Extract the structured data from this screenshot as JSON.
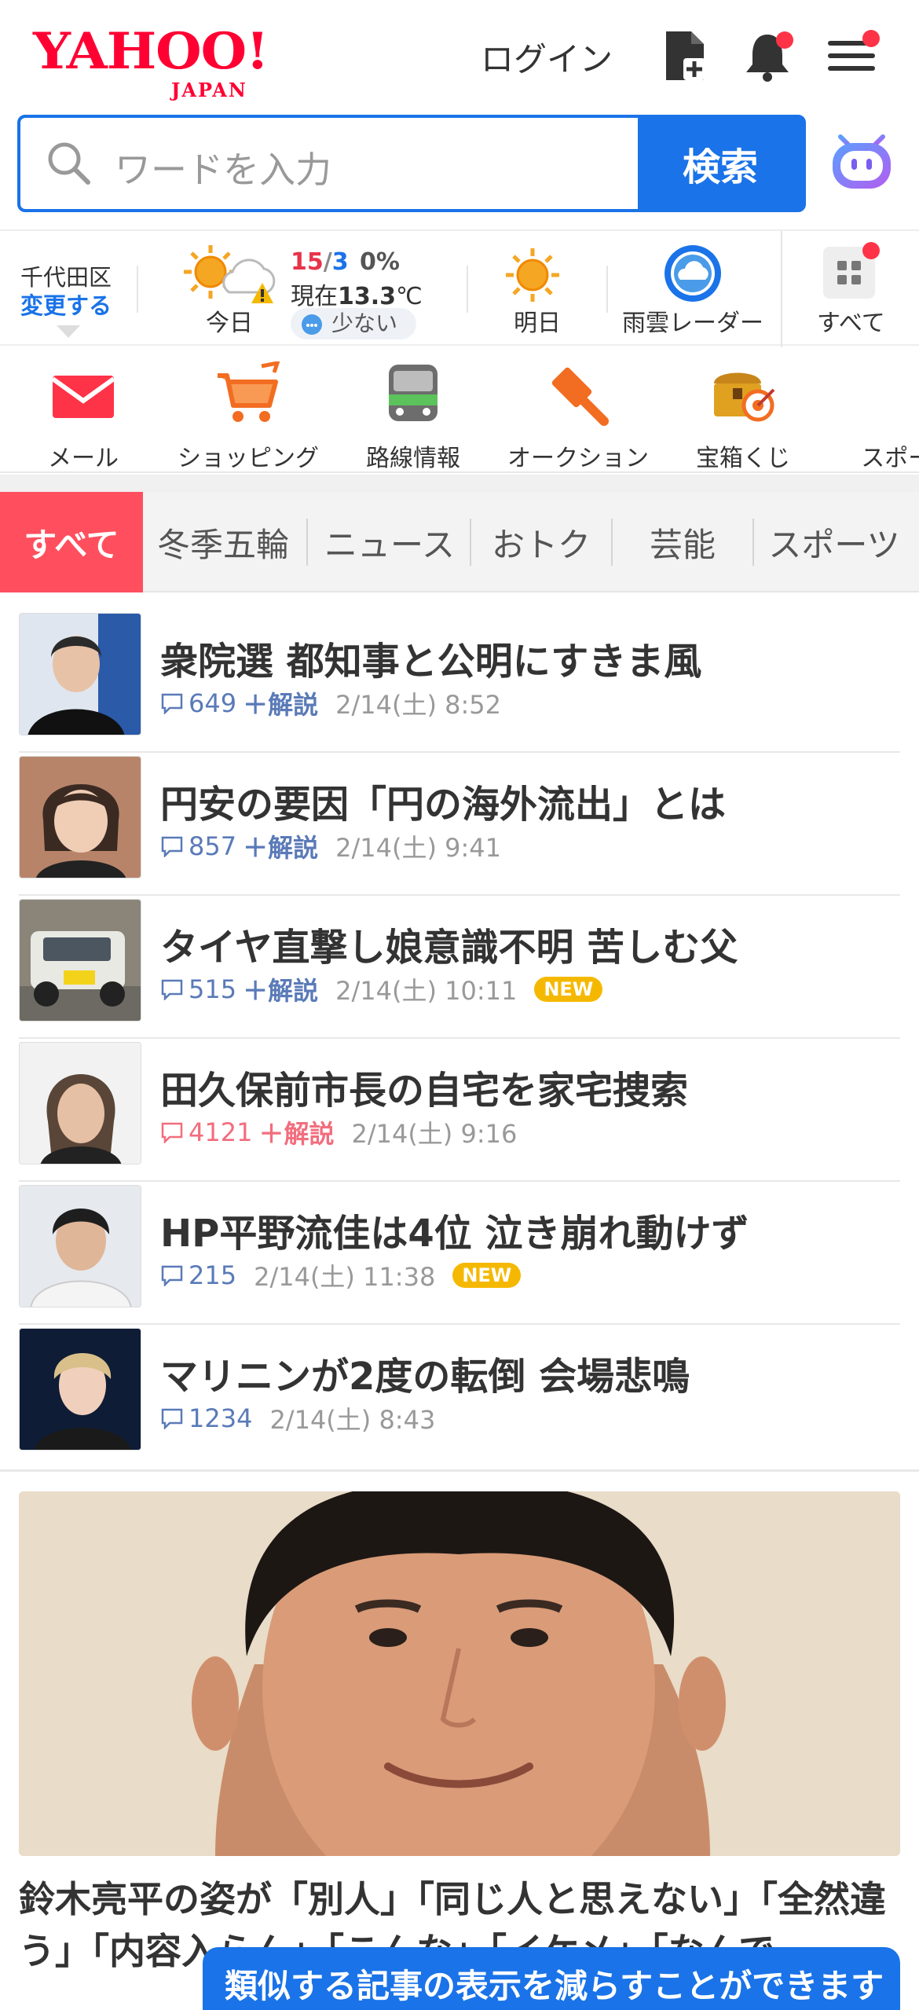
{
  "header": {
    "logo_main": "YAHOO!",
    "logo_sub": "JAPAN",
    "login_label": "ログイン"
  },
  "search": {
    "placeholder": "ワードを入力",
    "button_label": "検索"
  },
  "weather": {
    "location": "千代田区",
    "change_label": "変更する",
    "today_label": "今日",
    "temp_high": "15",
    "temp_sep": "/",
    "temp_low": "3",
    "precip": "0%",
    "now_prefix": "現在",
    "now_temp": "13.3",
    "now_unit": "℃",
    "rain_level": "少ない",
    "tomorrow_label": "明日",
    "radar_label": "雨雲レーダー",
    "all_label": "すべて"
  },
  "services": [
    {
      "label": "メール"
    },
    {
      "label": "ショッピング"
    },
    {
      "label": "路線情報"
    },
    {
      "label": "オークション"
    },
    {
      "label": "宝箱くじ"
    },
    {
      "label": "スポーツ"
    }
  ],
  "tabs": [
    {
      "label": "すべて"
    },
    {
      "label": "冬季五輪"
    },
    {
      "label": "ニュース"
    },
    {
      "label": "おトク"
    },
    {
      "label": "芸能"
    },
    {
      "label": "スポーツ"
    }
  ],
  "news": [
    {
      "title": "衆院選 都知事と公明にすきま風",
      "comments": "649",
      "plus": "＋解説",
      "time": "2/14(土) 8:52",
      "new": ""
    },
    {
      "title": "円安の要因「円の海外流出」とは",
      "comments": "857",
      "plus": "＋解説",
      "time": "2/14(土) 9:41",
      "new": ""
    },
    {
      "title": "タイヤ直撃し娘意識不明 苦しむ父",
      "comments": "515",
      "plus": "＋解説",
      "time": "2/14(土) 10:11",
      "new": "NEW"
    },
    {
      "title": "田久保前市長の自宅を家宅捜索",
      "comments": "4121",
      "plus": "＋解説",
      "time": "2/14(土) 9:16",
      "new": ""
    },
    {
      "title": "HP平野流佳は4位 泣き崩れ動けず",
      "comments": "215",
      "plus": "",
      "time": "2/14(土) 11:38",
      "new": "NEW"
    },
    {
      "title": "マリニンが2度の転倒 会場悲鳴",
      "comments": "1234",
      "plus": "",
      "time": "2/14(土) 8:43",
      "new": ""
    }
  ],
  "feature": {
    "title": "鈴木亮平の姿が「別人」「同じ人と思えない」「全然違う」「内容入らん」「こんな」「イケメ」「なんで"
  },
  "toast": {
    "text": "類似する記事の表示を減らすことができます"
  },
  "colors": {
    "brand_red": "#ff0033",
    "accent_blue": "#1a73e8",
    "tab_active": "#ff4f5e",
    "new_badge": "#f5b800"
  }
}
